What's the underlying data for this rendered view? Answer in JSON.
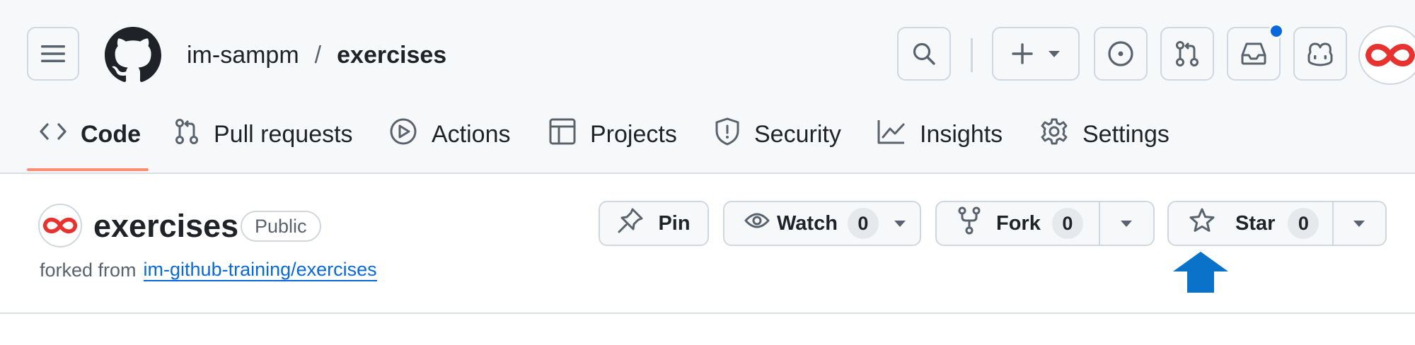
{
  "header": {
    "owner": "im-sampm",
    "separator": "/",
    "repo": "exercises",
    "icons": [
      "hamburger-icon",
      "github-logo",
      "search-icon",
      "plus-icon",
      "issues-icon",
      "pull-request-icon",
      "inbox-icon",
      "copilot-icon",
      "avatar"
    ],
    "notification_color": "#0969da"
  },
  "tabs": [
    {
      "label": "Code",
      "icon": "code-icon",
      "active": true
    },
    {
      "label": "Pull requests",
      "icon": "pull-request-icon"
    },
    {
      "label": "Actions",
      "icon": "play-icon"
    },
    {
      "label": "Projects",
      "icon": "table-icon"
    },
    {
      "label": "Security",
      "icon": "shield-icon"
    },
    {
      "label": "Insights",
      "icon": "graph-icon"
    },
    {
      "label": "Settings",
      "icon": "gear-icon"
    }
  ],
  "repo": {
    "title": "exercises",
    "visibility": "Public",
    "forked_prefix": "forked from",
    "forked_link": "im-github-training/exercises"
  },
  "actions": {
    "pin_label": "Pin",
    "watch_label": "Watch",
    "watch_count": "0",
    "fork_label": "Fork",
    "fork_count": "0",
    "star_label": "Star",
    "star_count": "0"
  },
  "colors": {
    "accent": "#0969da",
    "tab_underline": "#fd8c73",
    "arrow": "#0a72c8",
    "avatar_loop": "#e8322f"
  }
}
